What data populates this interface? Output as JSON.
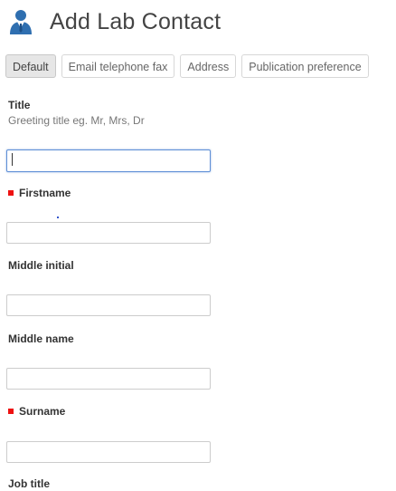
{
  "page": {
    "title": "Add Lab Contact",
    "icon": "contact-person-icon"
  },
  "tabs": [
    {
      "label": "Default",
      "active": true
    },
    {
      "label": "Email telephone fax",
      "active": false
    },
    {
      "label": "Address",
      "active": false
    },
    {
      "label": "Publication preference",
      "active": false
    }
  ],
  "fields": {
    "title": {
      "label": "Title",
      "help": "Greeting title eg. Mr, Mrs, Dr",
      "value": ""
    },
    "firstname": {
      "label": "Firstname",
      "required": true,
      "value": ""
    },
    "middle_initial": {
      "label": "Middle initial",
      "value": ""
    },
    "middle_name": {
      "label": "Middle name",
      "value": ""
    },
    "surname": {
      "label": "Surname",
      "required": true,
      "value": ""
    },
    "job_title": {
      "label": "Job title"
    }
  },
  "colors": {
    "required_marker": "#ee1111",
    "focus_border": "#5f8fd6",
    "icon_blue": "#2f6fb0"
  }
}
